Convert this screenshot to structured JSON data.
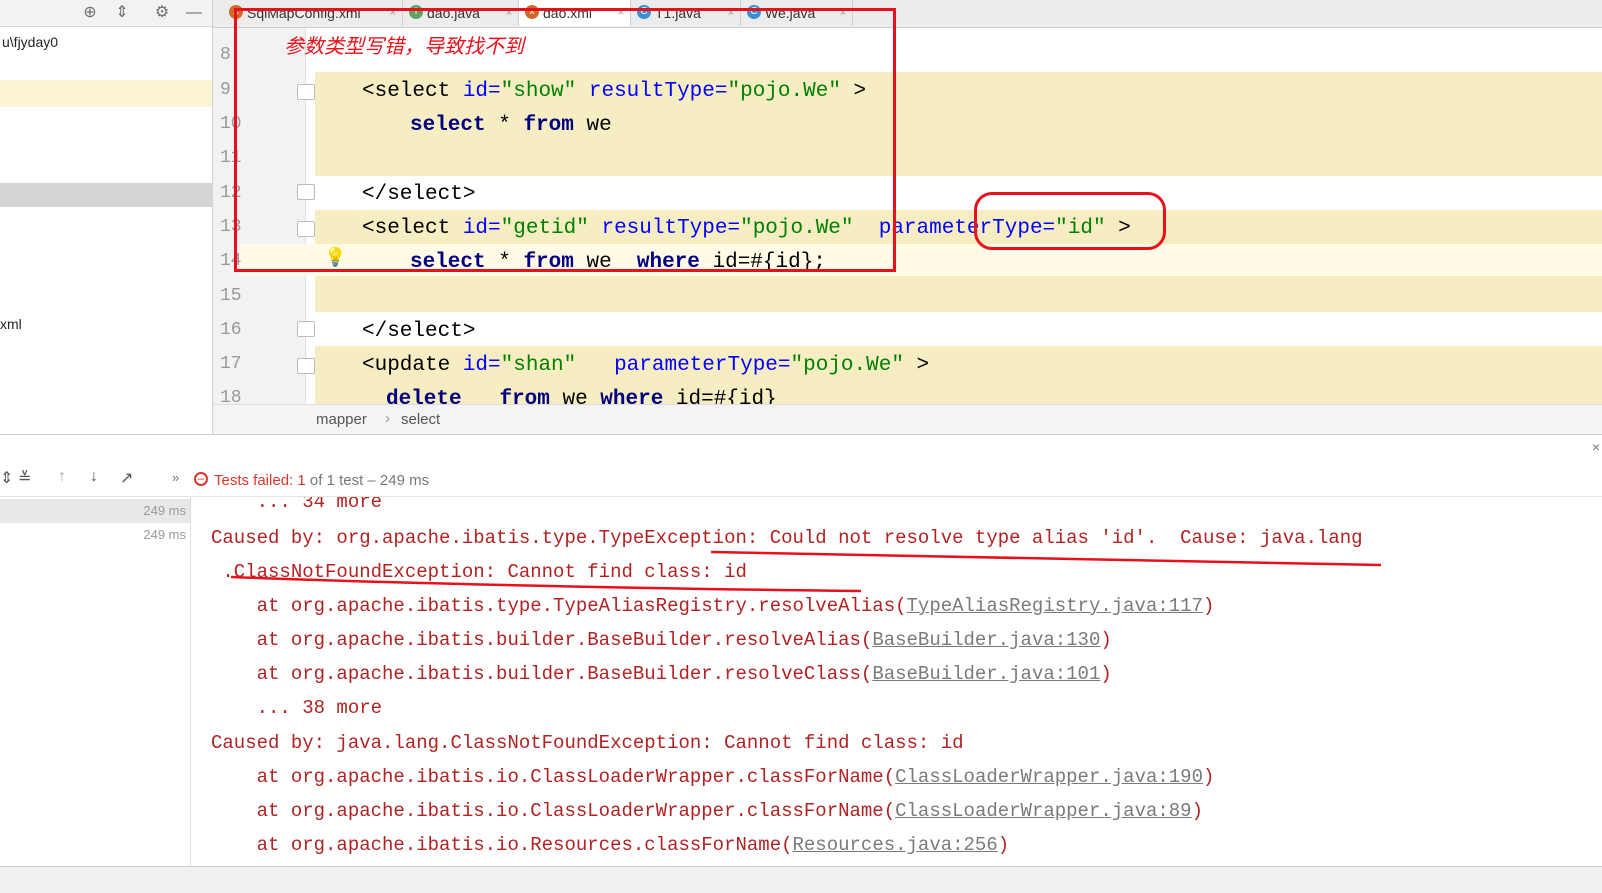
{
  "project": {
    "path_fragment": "u\\fjyday0",
    "item_xml": "xml"
  },
  "tabs": [
    {
      "label": "SqlMapConfig.xml"
    },
    {
      "label": "dao.java"
    },
    {
      "label": "dao.xml"
    },
    {
      "label": "T1.java"
    },
    {
      "label": "We.java"
    }
  ],
  "annotation": {
    "note": "参数类型写错，导致找不到"
  },
  "editor": {
    "line_numbers": [
      "8",
      "9",
      "10",
      "11",
      "12",
      "13",
      "14",
      "15",
      "16",
      "17",
      "18"
    ],
    "lines": {
      "l9": {
        "open": "<select ",
        "a1": "id=",
        "v1": "\"show\"",
        "a2": " resultType=",
        "v2": "\"pojo.We\"",
        "close": " >"
      },
      "l10": {
        "kw1": "select",
        "mid": " * ",
        "kw2": "from",
        "rest": " we"
      },
      "l12": {
        "text": "</select>"
      },
      "l13": {
        "open": "<select ",
        "a1": "id=",
        "v1": "\"getid\"",
        "a2": " resultType=",
        "v2": "\"pojo.We\"",
        "a3": "  parameterType=",
        "v3": "\"id\"",
        "close": " >"
      },
      "l14": {
        "kw1": "select",
        "mid": " * ",
        "kw2": "from",
        "rest1": " we  ",
        "kw3": "where",
        "rest2": " id=#{id};"
      },
      "l16": {
        "text": "</select>"
      },
      "l17": {
        "open": "<update ",
        "a1": "id=",
        "v1": "\"shan\"",
        "a2": "   parameterType=",
        "v2": "\"pojo.We\"",
        "close": " >"
      },
      "l18": {
        "kw1": "delete",
        "mid": "   ",
        "kw2": "from",
        "rest1": " we ",
        "kw3": "where",
        "rest2": " id=#{id}"
      }
    }
  },
  "breadcrumb": {
    "item1": "mapper",
    "sep": "›",
    "item2": "select"
  },
  "run": {
    "status_label": "Tests failed: ",
    "failed_count": "1",
    "status_rest": " of 1 test – 249 ms",
    "tree_time1": "249 ms",
    "tree_time2": "249 ms"
  },
  "console": {
    "lines": [
      {
        "text": "    ... 34 more"
      },
      {
        "text": "Caused by: org.apache.ibatis.type.TypeException: Could not resolve type alias 'id'.  Cause: java.lang"
      },
      {
        "text": " .ClassNotFoundException: Cannot find class: id"
      },
      {
        "text": "    at org.apache.ibatis.type.TypeAliasRegistry.resolveAlias(",
        "link": "TypeAliasRegistry.java:117",
        "end": ")"
      },
      {
        "text": "    at org.apache.ibatis.builder.BaseBuilder.resolveAlias(",
        "link": "BaseBuilder.java:130",
        "end": ")"
      },
      {
        "text": "    at org.apache.ibatis.builder.BaseBuilder.resolveClass(",
        "link": "BaseBuilder.java:101",
        "end": ")"
      },
      {
        "text": "    ... 38 more"
      },
      {
        "text": "Caused by: java.lang.ClassNotFoundException: Cannot find class: id"
      },
      {
        "text": "    at org.apache.ibatis.io.ClassLoaderWrapper.classForName(",
        "link": "ClassLoaderWrapper.java:190",
        "end": ")"
      },
      {
        "text": "    at org.apache.ibatis.io.ClassLoaderWrapper.classForName(",
        "link": "ClassLoaderWrapper.java:89",
        "end": ")"
      },
      {
        "text": "    at org.apache.ibatis.io.Resources.classForName(",
        "link": "Resources.java:256",
        "end": ")"
      }
    ]
  },
  "colors": {
    "annotation_red": "#e8101a",
    "highlight": "#f6edc3",
    "error_text": "#b22222"
  }
}
